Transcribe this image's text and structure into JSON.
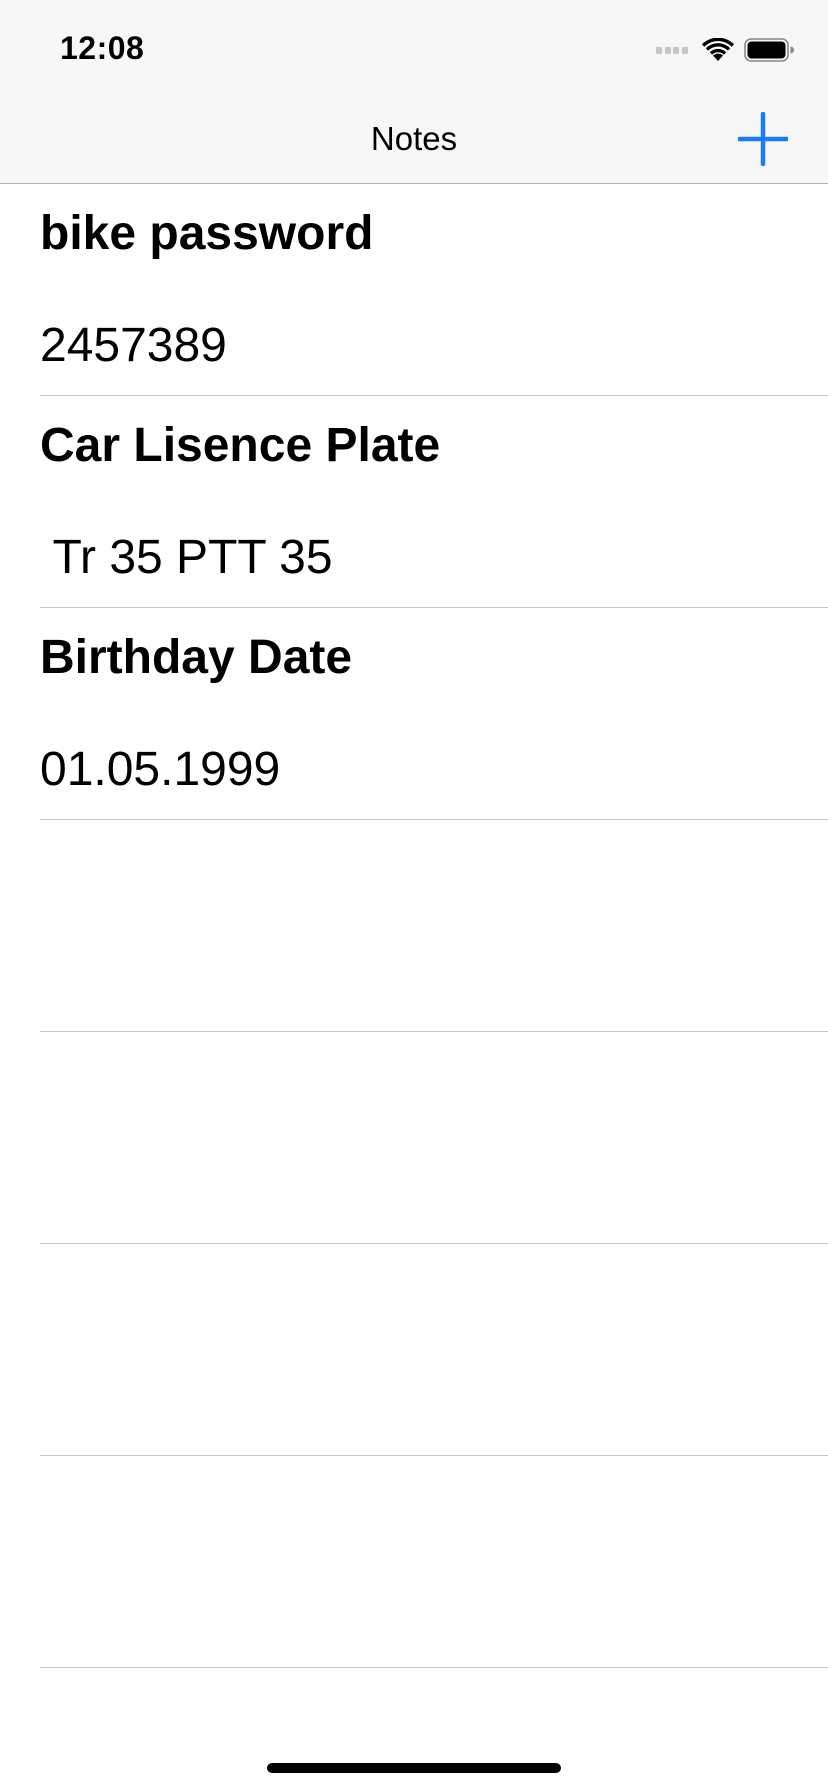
{
  "status_bar": {
    "time": "12:08"
  },
  "nav": {
    "title": "Notes",
    "add_icon": "plus-icon",
    "accent_color": "#1a7cf5"
  },
  "notes": [
    {
      "title": "bike password",
      "body": "2457389"
    },
    {
      "title": "Car Lisence Plate",
      "body": " Tr 35 PTT 35"
    },
    {
      "title": "Birthday Date",
      "body": "01.05.1999"
    },
    {
      "title": "",
      "body": ""
    },
    {
      "title": "",
      "body": ""
    },
    {
      "title": "",
      "body": ""
    },
    {
      "title": "",
      "body": ""
    }
  ]
}
